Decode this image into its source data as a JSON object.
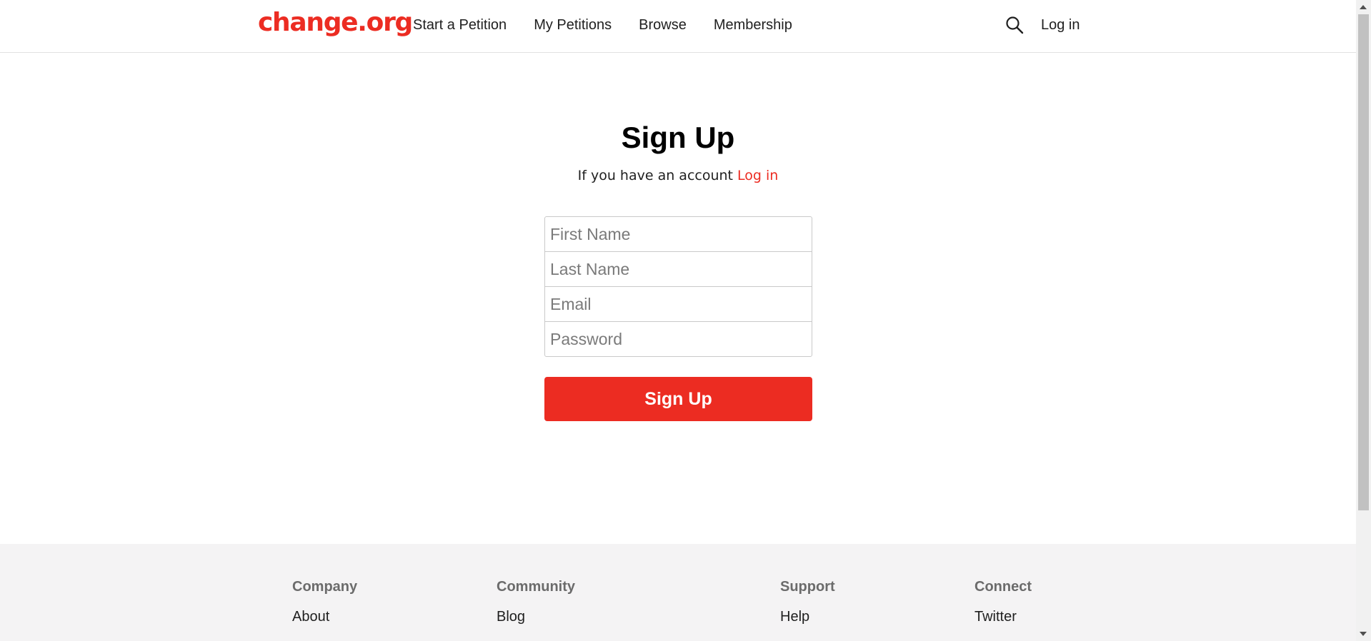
{
  "brand": {
    "logo_text": "change.org",
    "color": "#ec2c22"
  },
  "header": {
    "nav": [
      {
        "label": "Start a Petition"
      },
      {
        "label": "My Petitions"
      },
      {
        "label": "Browse"
      },
      {
        "label": "Membership"
      }
    ],
    "search_icon": "search-icon",
    "login_label": "Log in"
  },
  "signup": {
    "title": "Sign Up",
    "subtitle_text": "If you have an account",
    "login_link": "Log in",
    "fields": {
      "first_name": {
        "value": "",
        "placeholder": "First Name"
      },
      "last_name": {
        "value": "",
        "placeholder": "Last Name"
      },
      "email": {
        "value": "",
        "placeholder": "Email"
      },
      "password": {
        "value": "",
        "placeholder": "Password"
      }
    },
    "button_label": "Sign Up"
  },
  "footer": {
    "columns": [
      {
        "heading": "Company",
        "link": "About"
      },
      {
        "heading": "Community",
        "link": "Blog"
      },
      {
        "heading": "Support",
        "link": "Help"
      },
      {
        "heading": "Connect",
        "link": "Twitter"
      }
    ],
    "background": "#f4f3f4"
  }
}
